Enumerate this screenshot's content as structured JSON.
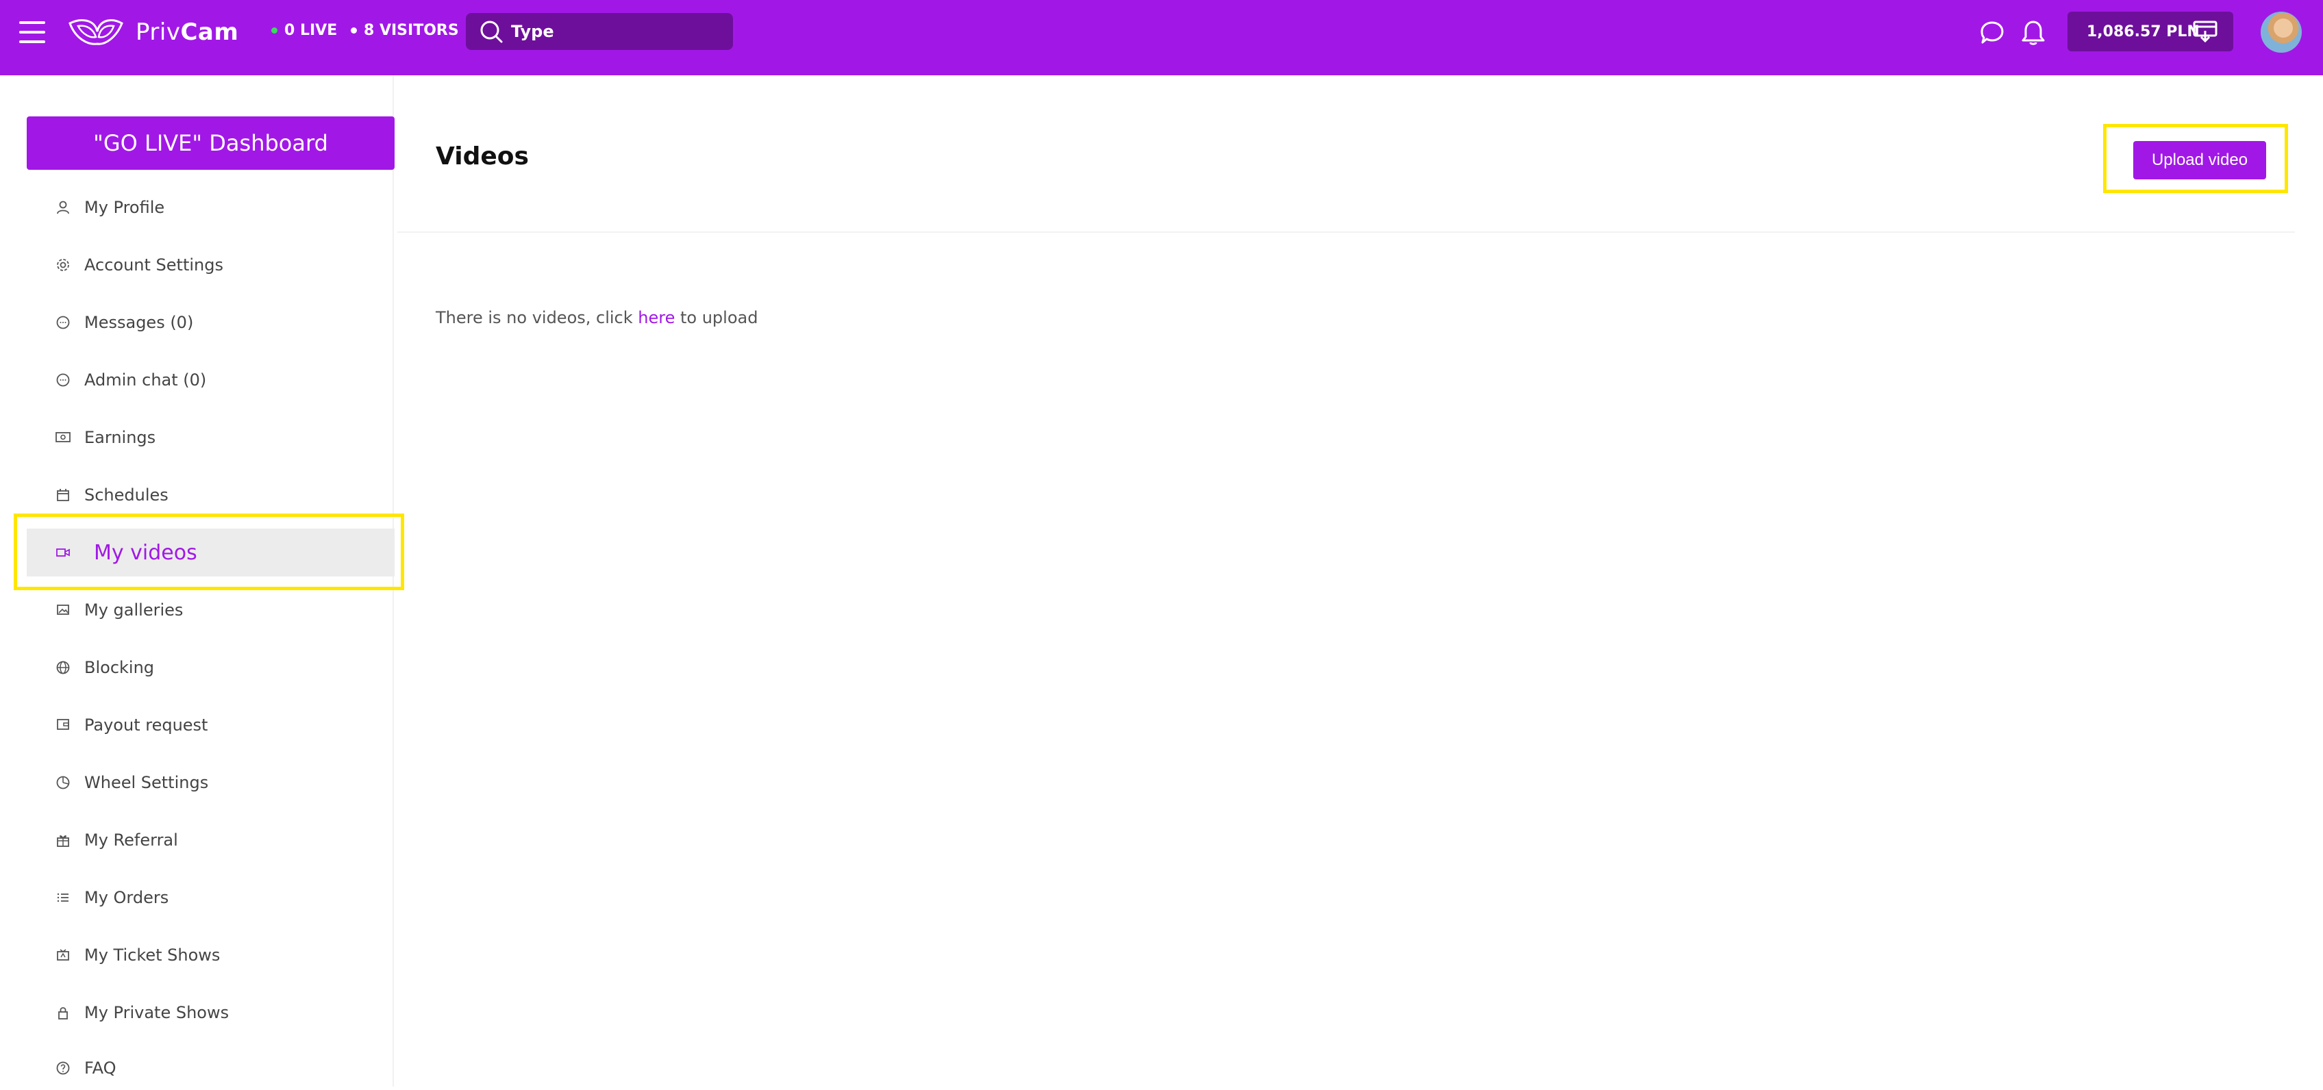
{
  "header": {
    "logo_light": "Priv",
    "logo_bold": "Cam",
    "live_count": "0 LIVE",
    "visitors_count": "8 VISITORS",
    "search_placeholder": "Type",
    "balance": "1,086.57 PLN",
    "colors": {
      "brand": "#a118e6",
      "dark": "#6e0f9c",
      "live_dot": "#3bdc5a"
    }
  },
  "sidebar": {
    "golive_label": "\"GO LIVE\" Dashboard",
    "items": [
      {
        "label": "My Profile",
        "icon": "user-icon"
      },
      {
        "label": "Account Settings",
        "icon": "gear-icon"
      },
      {
        "label": "Messages (0)",
        "icon": "chat-icon"
      },
      {
        "label": "Admin chat (0)",
        "icon": "chat-icon"
      },
      {
        "label": "Earnings",
        "icon": "cash-icon"
      },
      {
        "label": "Schedules",
        "icon": "calendar-icon"
      },
      {
        "label": "My videos",
        "icon": "video-icon",
        "active": true
      },
      {
        "label": "My galleries",
        "icon": "image-icon"
      },
      {
        "label": "Blocking",
        "icon": "globe-icon"
      },
      {
        "label": "Payout request",
        "icon": "wallet-icon"
      },
      {
        "label": "Wheel Settings",
        "icon": "pie-icon"
      },
      {
        "label": "My Referral",
        "icon": "gift-icon"
      },
      {
        "label": "My Orders",
        "icon": "list-icon"
      },
      {
        "label": "My Ticket Shows",
        "icon": "ticket-icon"
      },
      {
        "label": "My Private Shows",
        "icon": "lock-icon"
      },
      {
        "label": "FAQ",
        "icon": "help-icon"
      }
    ]
  },
  "main": {
    "title": "Videos",
    "upload_label": "Upload video",
    "empty_prefix": "There is no videos, click ",
    "empty_link": "here",
    "empty_suffix": " to upload"
  }
}
